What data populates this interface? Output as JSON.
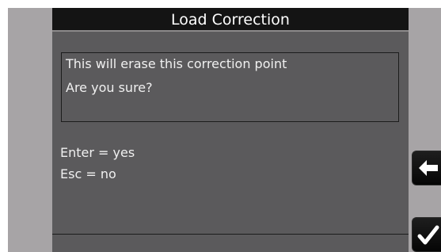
{
  "dialog": {
    "title": "Load Correction",
    "message_line1": "This will erase this correction point",
    "message_line2": "Are you sure?",
    "enter_hint": "Enter = yes",
    "esc_hint": "Esc = no"
  },
  "side_buttons": {
    "back_icon": "back-arrow-icon",
    "confirm_icon": "checkmark-icon"
  },
  "colors": {
    "dialog_background": "#5b5a5c",
    "title_bar": "#141414",
    "bezel": "#a7a4a6",
    "button": "#0a0a0a"
  }
}
